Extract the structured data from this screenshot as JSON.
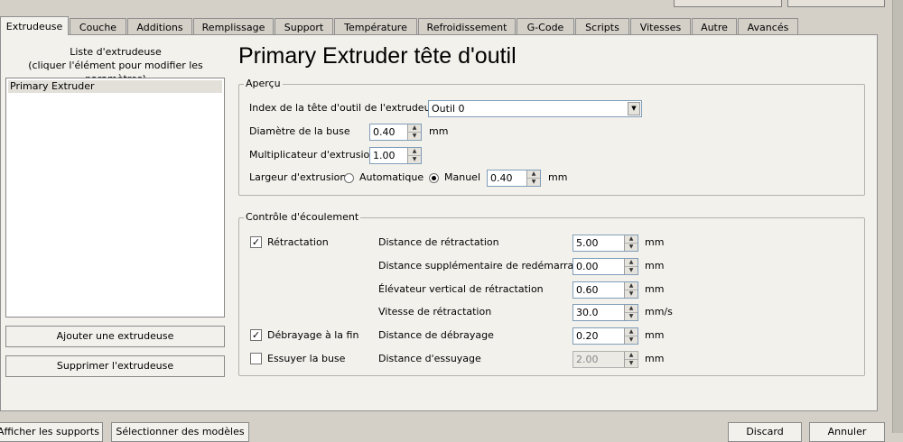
{
  "tabs": [
    "Extrudeuse",
    "Couche",
    "Additions",
    "Remplissage",
    "Support",
    "Température",
    "Refroidissement",
    "G-Code",
    "Scripts",
    "Vitesses",
    "Autre",
    "Avancés"
  ],
  "sidebar": {
    "title_line1": "Liste d'extrudeuse",
    "title_line2": "(cliquer l'élément pour modifier les paramètres)",
    "items": [
      "Primary Extruder"
    ],
    "add_button": "Ajouter une extrudeuse",
    "remove_button": "Supprimer l'extrudeuse"
  },
  "main": {
    "title": "Primary Extruder tête d'outil",
    "overview": {
      "legend": "Aperçu",
      "tool_index_label": "Index de la tête d'outil de l'extrudeuse",
      "tool_index_value": "Outil 0",
      "nozzle_label": "Diamètre de la buse",
      "nozzle_value": "0.40",
      "nozzle_unit": "mm",
      "multiplier_label": "Multiplicateur d'extrusion",
      "multiplier_value": "1.00",
      "width_label": "Largeur d'extrusion",
      "auto_label": "Automatique",
      "manual_label": "Manuel",
      "width_value": "0.40",
      "width_unit": "mm",
      "mode": "Manuel"
    },
    "flow": {
      "legend": "Contrôle d'écoulement",
      "retraction_label": "Rétractation",
      "retraction_checked": true,
      "coast_label": "Débrayage à la fin",
      "coast_checked": true,
      "wipe_label": "Essuyer la buse",
      "wipe_checked": false,
      "fields": [
        {
          "label": "Distance de rétractation",
          "value": "5.00",
          "unit": "mm"
        },
        {
          "label": "Distance supplémentaire de redémarrage",
          "value": "0.00",
          "unit": "mm"
        },
        {
          "label": "Élévateur vertical de rétractation",
          "value": "0.60",
          "unit": "mm"
        },
        {
          "label": "Vitesse de rétractation",
          "value": "30.0",
          "unit": "mm/s"
        },
        {
          "label": "Distance de débrayage",
          "value": "0.20",
          "unit": "mm"
        },
        {
          "label": "Distance d'essuyage",
          "value": "2.00",
          "unit": "mm"
        }
      ]
    }
  },
  "bottom": {
    "left1": "Afficher les supports",
    "left2": "Sélectionner des modèles",
    "right1": "Discard",
    "right2": "Annuler"
  }
}
